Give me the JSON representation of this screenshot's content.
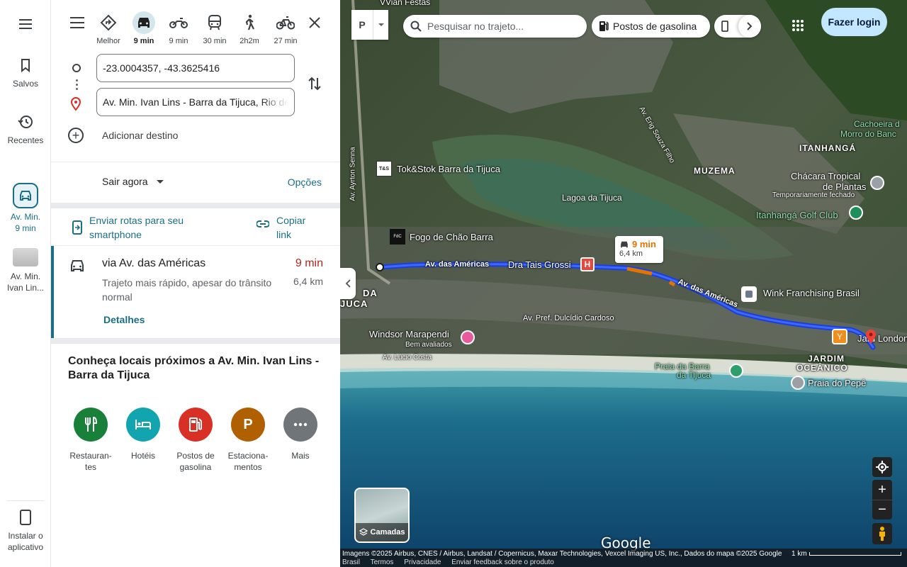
{
  "rail": {
    "saved_label": "Salvos",
    "recent_label": "Recentes",
    "trip_label": "Av. Min.",
    "trip_time": "9 min",
    "dest_label1": "Av. Min.",
    "dest_label2": "Ivan Lin...",
    "install_label1": "Instalar o",
    "install_label2": "aplicativo"
  },
  "modes": [
    {
      "name": "best",
      "label": "Melhor"
    },
    {
      "name": "car",
      "label": "9 min",
      "active": true
    },
    {
      "name": "motorcycle",
      "label": "9 min"
    },
    {
      "name": "transit",
      "label": "30 min"
    },
    {
      "name": "walk",
      "label": "2h2m"
    },
    {
      "name": "bike",
      "label": "27 min"
    }
  ],
  "directions": {
    "origin_value": "-23.0004357, -43.3625416",
    "destination_value": "Av. Min. Ivan Lins - Barra da Tijuca, Rio de Janeiro",
    "add_destination": "Adicionar destino",
    "depart_label": "Sair agora",
    "options_label": "Opções",
    "send_phone": [
      "Enviar rotas para seu",
      "smartphone"
    ],
    "copy_link": [
      "Copiar",
      "link"
    ]
  },
  "route": {
    "via": "via Av. das Américas",
    "desc": "Trajeto mais rápido, apesar do trânsito normal",
    "time": "9 min",
    "distance": "6,4 km",
    "details_label": "Detalhes"
  },
  "nearby": {
    "title": "Conheça locais próximos a Av. Min. Ivan Lins - Barra da Tijuca",
    "categories": [
      {
        "label1": "Restauran-",
        "label2": "tes",
        "color": "#188038"
      },
      {
        "label1": "Hotéis",
        "label2": "",
        "color": "#12a4af"
      },
      {
        "label1": "Postos de",
        "label2": "gasolina",
        "color": "#d93025"
      },
      {
        "label1": "Estaciona-",
        "label2": "mentos",
        "color": "#b06000"
      },
      {
        "label1": "Mais",
        "label2": "",
        "color": "#70757a"
      }
    ],
    "parking_glyph": "P"
  },
  "map": {
    "search_placeholder": "Pesquisar no trajeto...",
    "chip_gas": "Postos de gasolina",
    "login_label": "Fazer login",
    "layers_label": "Camadas",
    "bubble_time": "9 min",
    "bubble_dist": "6,4 km",
    "google_logo": "Google",
    "labels": {
      "vivian": "VVian Festas",
      "cachoeira1": "Cachoeira d",
      "cachoeira2": "Morro do Banc",
      "itanhanga": "ITANHANGÁ",
      "muzema": "MUZEMA",
      "chacara1": "Chácara Tropical",
      "chacara2": "de Plantas",
      "chacara3": "Temporariamente fechado",
      "golf": "Itanhangá Golf Club",
      "tokstok": "Tok&Stok Barra da Tijuca",
      "lagoa": "Lagoa da Tijuca",
      "fogo": "Fogo de Chão Barra",
      "americas1": "Av. das Américas",
      "americas2": "Av. das Américas",
      "dra": "Dra Tais Grossi",
      "wink": "Wink Franchising Brasil",
      "pref": "Av. Pref. Dulcídio Cardoso",
      "windsor1": "Windsor Marapendi",
      "windsor2": "Bem avaliados",
      "lucio": "Av. Lúcio Costa",
      "jardim1": "JARDIM",
      "jardim2": "OCEÂNICO",
      "praia_barra1": "Praia da Barra",
      "praia_barra2": "da Tijuca",
      "pepe": "Praia do Pepê",
      "ayrton": "Av. Ayrton Senna",
      "erig": "Av. Erig Souza Filho",
      "da": "DA",
      "juca": "JUCA",
      "jard_london": "Jard London"
    },
    "attribution": "Imagens ©2025 Airbus, CNES / Airbus, Landsat / Copernicus, Maxar Technologies, Vexcel Imaging US, Inc., Dados do mapa ©2025 Google",
    "footer": [
      "Brasil",
      "Termos",
      "Privacidade",
      "Enviar feedback sobre o produto"
    ],
    "scale": "1 km"
  },
  "colors": {
    "accent": "#1a6f86",
    "route": "#1a3fe0",
    "traffic": "#e37400",
    "time_red": "#b3261e"
  }
}
